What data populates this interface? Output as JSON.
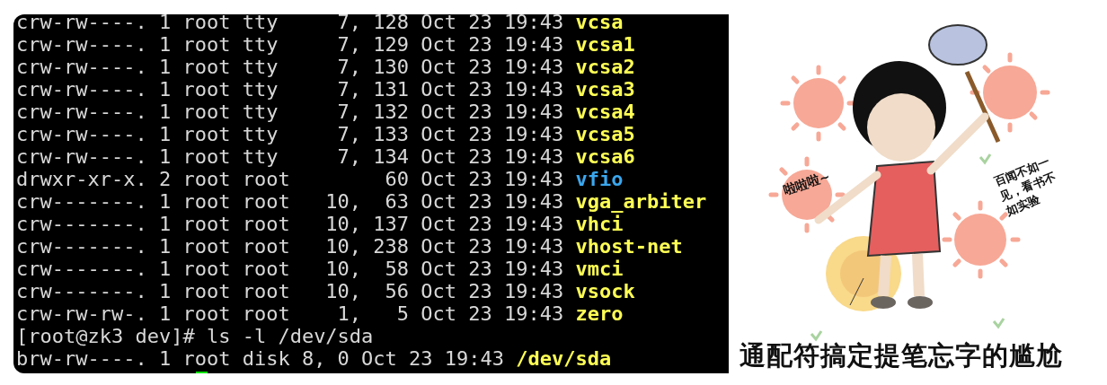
{
  "terminal": {
    "lines": [
      {
        "kind": "char",
        "text": "crw-rw----. 1 root tty     7, 128 Oct 23 19:43",
        "name": "vcsa"
      },
      {
        "kind": "char",
        "text": "crw-rw----. 1 root tty     7, 129 Oct 23 19:43",
        "name": "vcsa1"
      },
      {
        "kind": "char",
        "text": "crw-rw----. 1 root tty     7, 130 Oct 23 19:43",
        "name": "vcsa2"
      },
      {
        "kind": "char",
        "text": "crw-rw----. 1 root tty     7, 131 Oct 23 19:43",
        "name": "vcsa3"
      },
      {
        "kind": "char",
        "text": "crw-rw----. 1 root tty     7, 132 Oct 23 19:43",
        "name": "vcsa4"
      },
      {
        "kind": "char",
        "text": "crw-rw----. 1 root tty     7, 133 Oct 23 19:43",
        "name": "vcsa5"
      },
      {
        "kind": "char",
        "text": "crw-rw----. 1 root tty     7, 134 Oct 23 19:43",
        "name": "vcsa6"
      },
      {
        "kind": "dir",
        "text": "drwxr-xr-x. 2 root root        60 Oct 23 19:43",
        "name": "vfio"
      },
      {
        "kind": "char",
        "text": "crw-------. 1 root root   10,  63 Oct 23 19:43",
        "name": "vga_arbiter"
      },
      {
        "kind": "char",
        "text": "crw-------. 1 root root   10, 137 Oct 23 19:43",
        "name": "vhci"
      },
      {
        "kind": "char",
        "text": "crw-------. 1 root root   10, 238 Oct 23 19:43",
        "name": "vhost-net"
      },
      {
        "kind": "char",
        "text": "crw-------. 1 root root   10,  58 Oct 23 19:43",
        "name": "vmci"
      },
      {
        "kind": "char",
        "text": "crw-------. 1 root root   10,  56 Oct 23 19:43",
        "name": "vsock"
      },
      {
        "kind": "char",
        "text": "crw-rw-rw-. 1 root root    1,   5 Oct 23 19:43",
        "name": "zero"
      },
      {
        "kind": "command",
        "text": "[root@zk3 dev]# ls -l /dev/sda"
      },
      {
        "kind": "block",
        "text": "brw-rw----. 1 root disk 8, 0 Oct 23 19:43",
        "name": "/dev/sda"
      }
    ]
  },
  "illustration": {
    "speech": "啦啦啦~",
    "note": "百闻不如一见，看书不如实验",
    "caption": "通配符搞定提笔忘字的尴尬"
  }
}
